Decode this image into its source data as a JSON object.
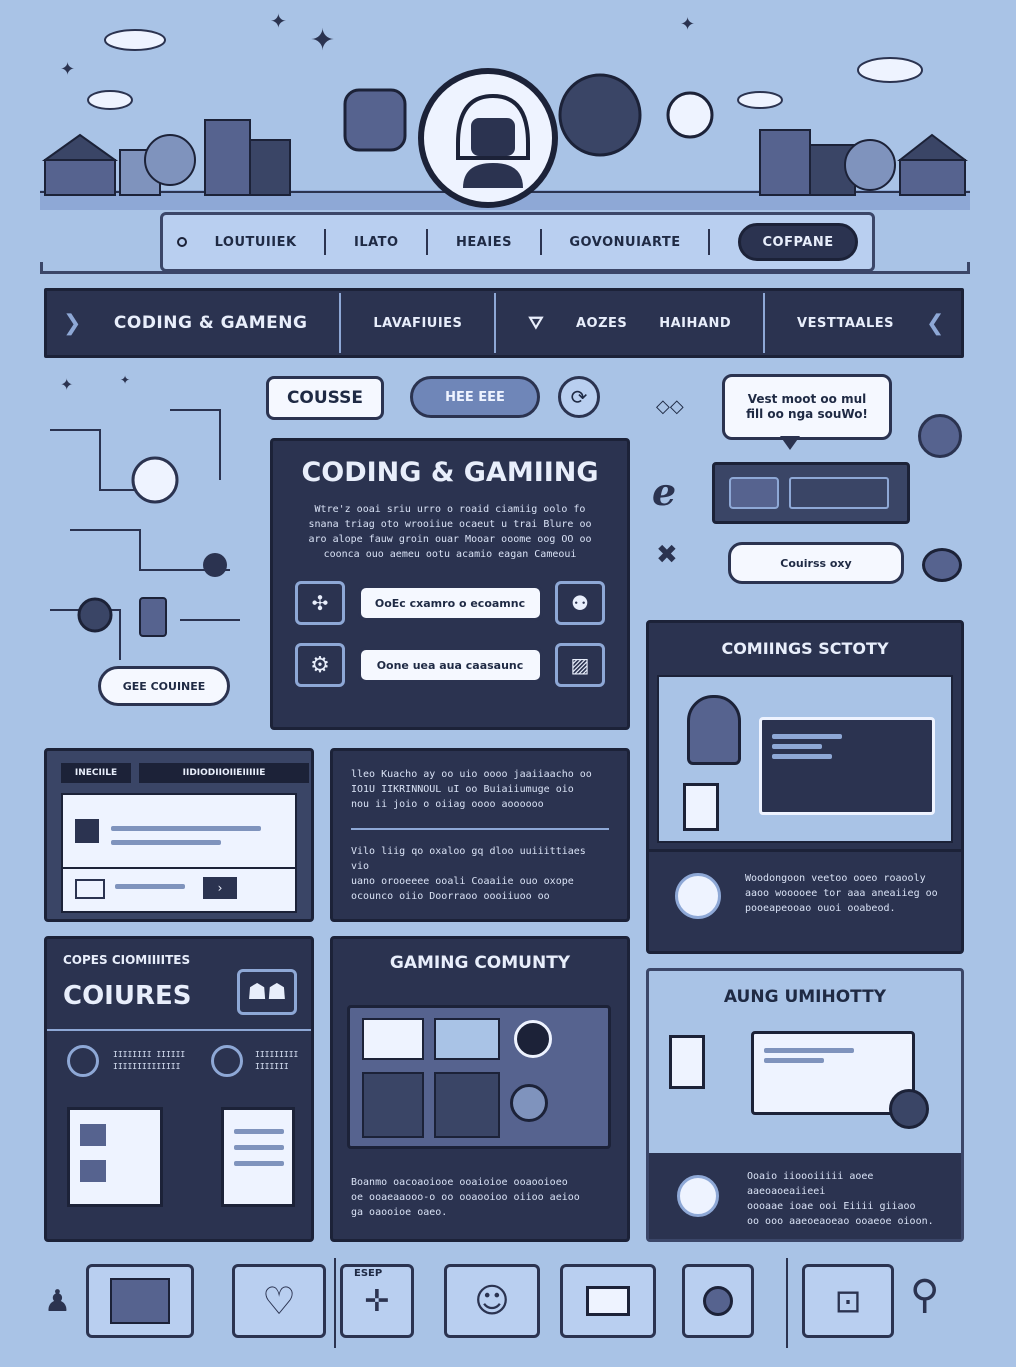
{
  "header": {
    "nav": [
      "LOUTUIIEK",
      "ILATO",
      "HEAIES",
      "GOVONUIARTE"
    ],
    "nav_button": "COFPANE"
  },
  "banner": {
    "title": "CODING & GAMENG",
    "items": [
      "LAVAFIUIES",
      "AOZES",
      "HAIHAND",
      "VESTTAALES"
    ]
  },
  "pills": {
    "course": "COUSSE",
    "hee": "HEE EEE",
    "get_course": "GEE COUINEE",
    "course_oxy": "Couirss oxy"
  },
  "speech": "Vest moot oo mul\nfill oo nga souWo!",
  "main": {
    "title": "CODING & GAMIING",
    "text": "Wtre'z ooai sriu urro o roaid ciamiig oolo fo\nsnana triag oto wrooiiue ocaeut u trai Blure oo\naro alope fauw groin ouar Mooar ooome oog OO oo\ncoonca ouo aemeu ootu acamio eagan Cameoui",
    "button1": "OoEc cxamro o ecoamnc",
    "button2": "Oone uea aua caasaunc"
  },
  "window_card": {
    "tab1": "INECIILE",
    "tab2": "IIDIODIIOIIEIIIIIE"
  },
  "text_card": {
    "p1": "lleo Kuacho ay oo uio oooo jaaiiaacho oo\nIO1U IIKRINNOUL uI oo Buiaiiumuge oio\nnou ii joio o oiiag oooo aoooooo",
    "p2": "Vilo liig qo oxaloo gq dloo uuiiittiaes vio\nuano orooeeee ooali Coaaiie ouo oxope\nocounco oiio Doorraoo oooiiuoo oo"
  },
  "comm_society": {
    "title": "COMIINGS SCTOTY",
    "text": "Woodongoon veetoo ooeo roaooly\naaoo wooooee tor aaa aneaiieg oo\npooeapeooao ouoi ooabeod."
  },
  "courses_card": {
    "subtitle": "COPES CIOMIIIITES",
    "title": "COIURES",
    "item1": "IIIIIIII IIIIII\nIIIIIIIIIIIIII",
    "item2": "IIIIIIIII\nIIIIIII"
  },
  "gaming_card": {
    "title": "GAMING COMUNTY",
    "text": "Boanmo oacoaoiooe ooaioioe ooaooioeo\noe ooaeaaooo-o oo ooaooioo oiioo aeioo\nga oaooioe oaeo."
  },
  "aung_card": {
    "title": "AUNG UMIHOTTY",
    "text": "Ooaio iioooiiiii aoee aaeoaoeaiieei\noooaae ioae ooi Eiiii giiaoo\noo ooo aaeoeaoeao ooaeoe oioon."
  },
  "footer_tag": "ESEP",
  "colors": {
    "bg": "#a9c3e6",
    "dark": "#2b3350",
    "light": "#b9cff0",
    "accent": "#6f86b8"
  }
}
